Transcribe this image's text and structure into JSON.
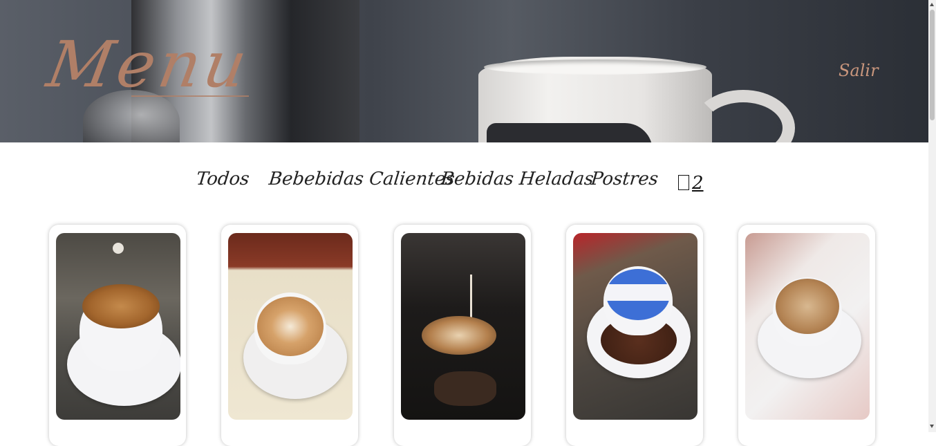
{
  "hero": {
    "title": "Menu",
    "logout_label": "Salir"
  },
  "nav": {
    "items": [
      {
        "label": "Todos"
      },
      {
        "label": "Bebebidas Calientes"
      },
      {
        "label": "Bebidas Heladas"
      },
      {
        "label": "Postres"
      }
    ],
    "cart_count": "2"
  },
  "products": [
    {
      "photo": "cappuccino-tree-art-photo"
    },
    {
      "photo": "latte-tulip-art-photo"
    },
    {
      "photo": "dark-latte-pour-photo"
    },
    {
      "photo": "flag-latte-photo"
    },
    {
      "photo": "i-love-papa-latte-photo"
    }
  ],
  "colors": {
    "accent": "#b07f67",
    "logout": "#c9967d"
  }
}
